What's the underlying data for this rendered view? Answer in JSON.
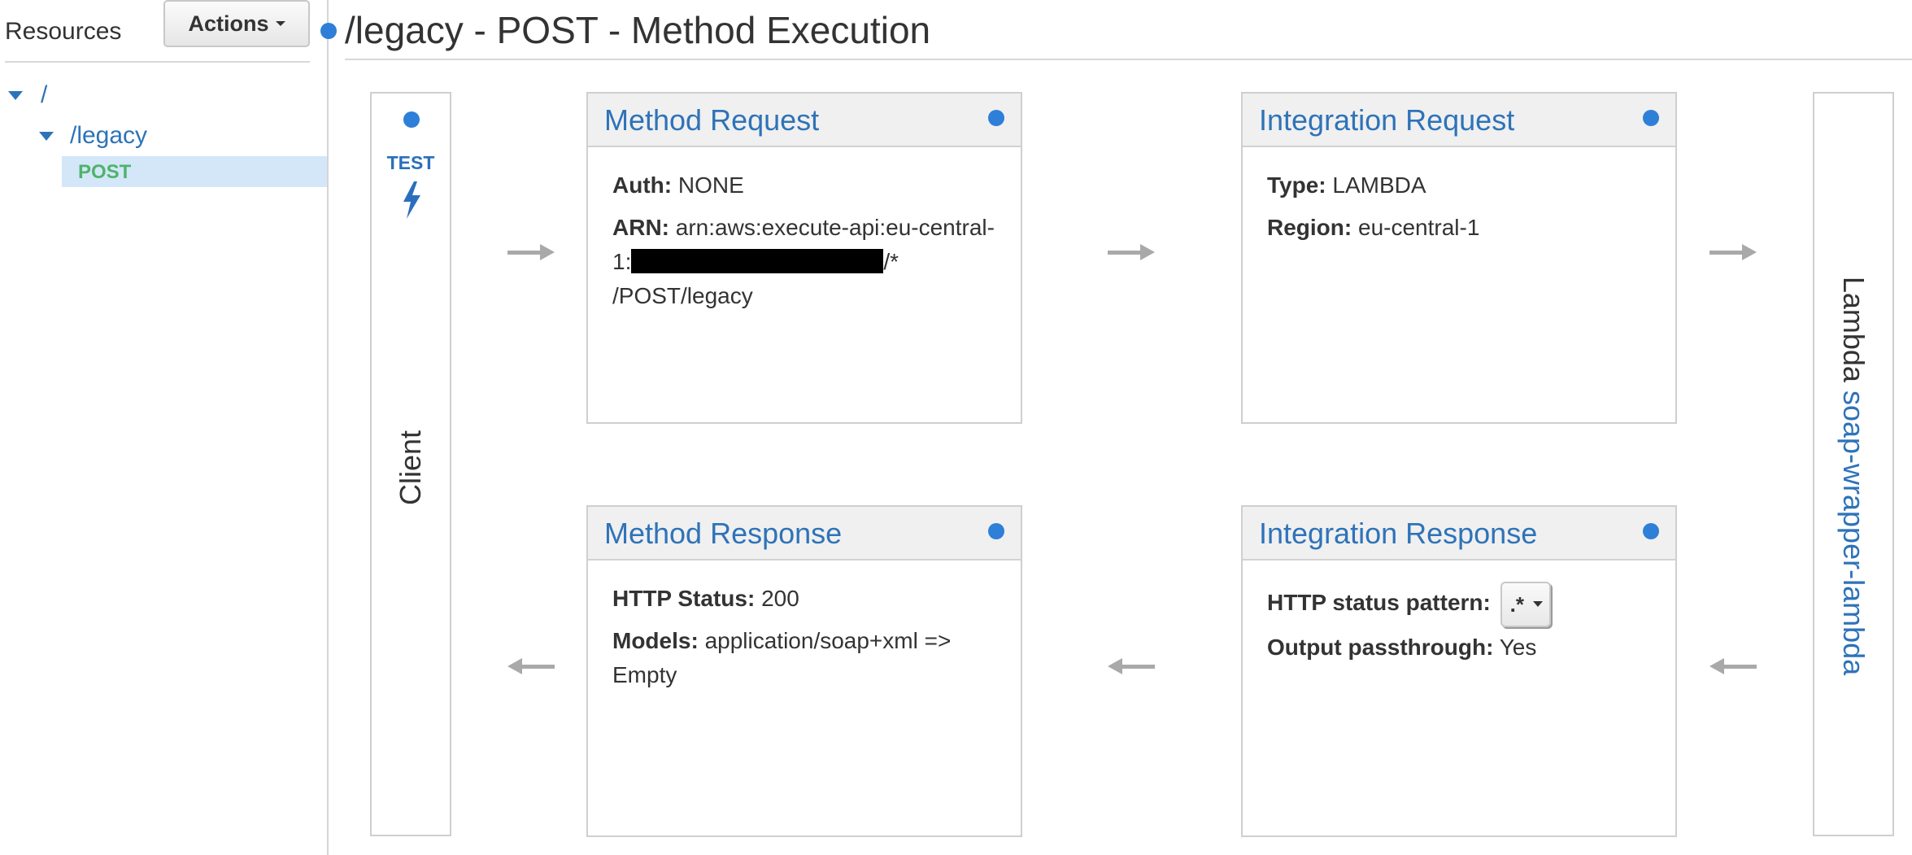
{
  "sidebar": {
    "resources_label": "Resources",
    "actions_label": "Actions",
    "tree": {
      "root": "/",
      "legacy": "/legacy",
      "post": "POST"
    }
  },
  "header": {
    "title": "/legacy - POST - Method Execution"
  },
  "client": {
    "test_label": "TEST",
    "label": "Client"
  },
  "method_request": {
    "title": "Method Request",
    "auth_label": "Auth:",
    "auth_value": "NONE",
    "arn_label": "ARN:",
    "arn_line1": "arn:aws:execute-api:eu-central-",
    "arn_line2_prefix": "1:",
    "arn_line2_suffix": "/*",
    "arn_line3": "/POST/legacy"
  },
  "integration_request": {
    "title": "Integration Request",
    "type_label": "Type:",
    "type_value": "LAMBDA",
    "region_label": "Region:",
    "region_value": "eu-central-1"
  },
  "method_response": {
    "title": "Method Response",
    "status_label": "HTTP Status:",
    "status_value": "200",
    "models_label": "Models:",
    "models_line1": "application/soap+xml =>",
    "models_line2": "Empty"
  },
  "integration_response": {
    "title": "Integration Response",
    "pattern_label": "HTTP status pattern:",
    "pattern_value": ".*",
    "passthrough_label": "Output passthrough:",
    "passthrough_value": "Yes"
  },
  "lambda": {
    "prefix": "Lambda",
    "function_name": "soap-wrapper-lambda"
  },
  "colors": {
    "accent": "#2e73b8",
    "dot": "#2e7fd8",
    "method_green": "#4fb36a",
    "arrow_gray": "#a9a9a9"
  }
}
